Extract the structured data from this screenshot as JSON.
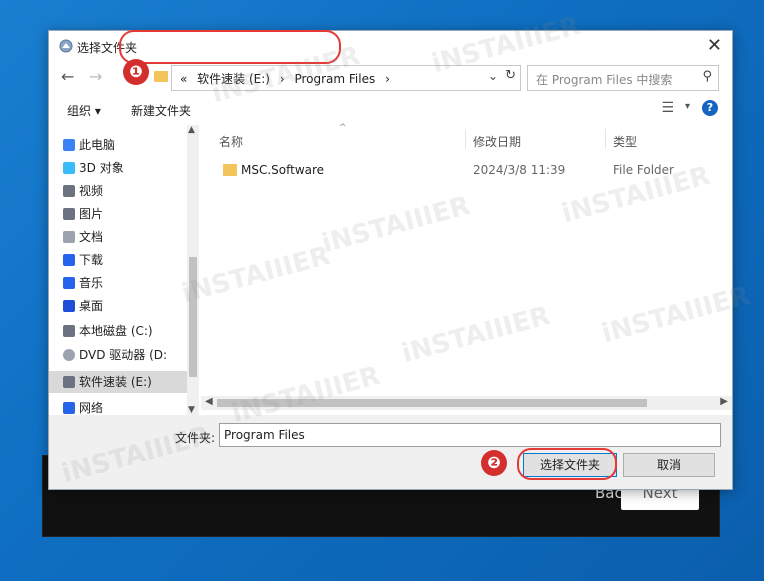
{
  "background": {
    "back_label": "Back",
    "next_label": "Next"
  },
  "dialog": {
    "title": "选择文件夹",
    "close_glyph": "✕"
  },
  "nav": {
    "back_glyph": "←",
    "forward_glyph": "→",
    "up_glyph": "↑",
    "breadcrumb_prefix": "«",
    "breadcrumb": [
      "软件速装 (E:)",
      "›",
      "Program Files",
      "›"
    ],
    "dropdown_glyph": "⌄",
    "refresh_glyph": "↻",
    "search_placeholder": "在 Program Files 中搜索",
    "search_glyph": "⚲"
  },
  "toolbar": {
    "organize": "组织 ▾",
    "new_folder": "新建文件夹",
    "view_glyph": "☰",
    "view_dropdown": "▾",
    "help": "?"
  },
  "sidebar": {
    "items": [
      {
        "label": "此电脑",
        "icon": "computer-icon",
        "color": "#3b82f6"
      },
      {
        "label": "3D 对象",
        "icon": "cube-icon",
        "color": "#38bdf8"
      },
      {
        "label": "视频",
        "icon": "video-icon",
        "color": "#6b7280"
      },
      {
        "label": "图片",
        "icon": "picture-icon",
        "color": "#6b7280"
      },
      {
        "label": "文档",
        "icon": "document-icon",
        "color": "#9ca3af"
      },
      {
        "label": "下载",
        "icon": "download-icon",
        "color": "#2563eb"
      },
      {
        "label": "音乐",
        "icon": "music-icon",
        "color": "#2563eb"
      },
      {
        "label": "桌面",
        "icon": "desktop-icon",
        "color": "#1d4ed8"
      },
      {
        "label": "本地磁盘 (C:)",
        "icon": "drive-icon",
        "color": "#6b7280"
      },
      {
        "label": "DVD 驱动器 (D:",
        "icon": "dvd-icon",
        "color": "#9ca3af"
      },
      {
        "label": "软件速装 (E:)",
        "icon": "drive-icon",
        "color": "#6b7280"
      },
      {
        "label": "网络",
        "icon": "network-icon",
        "color": "#2563eb"
      }
    ]
  },
  "content": {
    "columns": [
      "名称",
      "修改日期",
      "类型"
    ],
    "rows": [
      {
        "name": "MSC.Software",
        "date": "2024/3/8 11:39",
        "type": "File Folder"
      }
    ]
  },
  "bottom": {
    "folder_label": "文件夹:",
    "folder_value": "Program Files",
    "select_button": "选择文件夹",
    "cancel_button": "取消"
  },
  "annotations": {
    "badge1": "❶",
    "badge2": "❷"
  },
  "watermark": "iNSTAIIIER"
}
